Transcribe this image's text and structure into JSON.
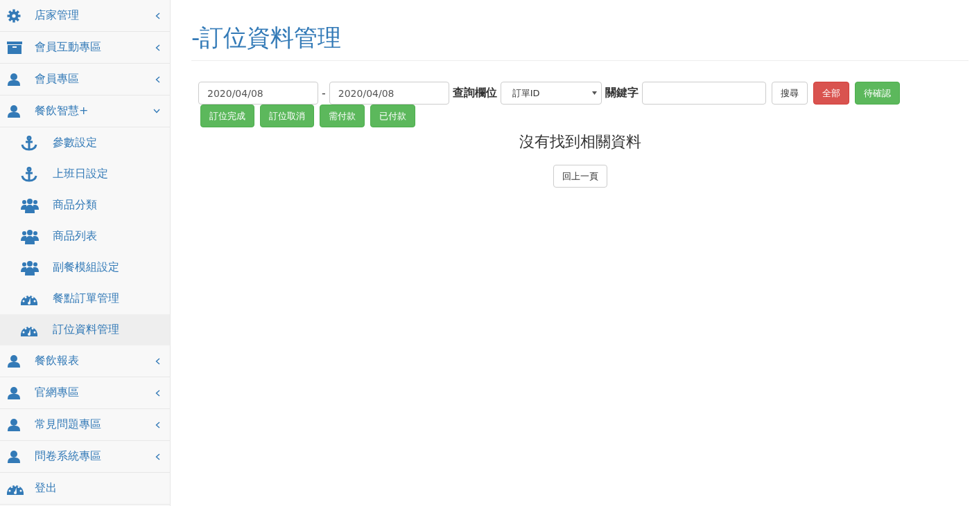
{
  "sidebar": {
    "items": [
      {
        "label": "店家管理",
        "kind": "menu",
        "expanded": false
      },
      {
        "label": "會員互動專區",
        "kind": "menu",
        "expanded": false
      },
      {
        "label": "會員專區",
        "kind": "menu",
        "expanded": false
      },
      {
        "label": "餐飲智慧+",
        "kind": "menu",
        "expanded": true,
        "children": [
          {
            "label": "參數設定",
            "selected": false
          },
          {
            "label": "上班日設定",
            "selected": false
          },
          {
            "label": "商品分類",
            "selected": false
          },
          {
            "label": "商品列表",
            "selected": false
          },
          {
            "label": "副餐模組設定",
            "selected": false
          },
          {
            "label": "餐點訂單管理",
            "selected": false
          },
          {
            "label": "訂位資料管理",
            "selected": true
          }
        ]
      },
      {
        "label": "餐飲報表",
        "kind": "menu",
        "expanded": false
      },
      {
        "label": "官網專區",
        "kind": "menu",
        "expanded": false
      },
      {
        "label": "常見問題專區",
        "kind": "menu",
        "expanded": false
      },
      {
        "label": "問卷系統專區",
        "kind": "menu",
        "expanded": false
      },
      {
        "label": "登出",
        "kind": "link"
      }
    ]
  },
  "page": {
    "title": "-訂位資料管理"
  },
  "filter": {
    "date_from": "2020/04/08",
    "separator": "-",
    "date_to": "2020/04/08",
    "field_label": "查詢欄位",
    "field_value": "訂單ID",
    "keyword_label": "關鍵字",
    "buttons": [
      {
        "label": "搜尋",
        "kind": "default"
      },
      {
        "label": "全部",
        "kind": "danger"
      },
      {
        "label": "待確認",
        "kind": "success"
      },
      {
        "label": "訂位完成",
        "kind": "success"
      },
      {
        "label": "訂位取消",
        "kind": "success"
      },
      {
        "label": "需付款",
        "kind": "success"
      },
      {
        "label": "已付款",
        "kind": "success"
      }
    ]
  },
  "result": {
    "message": "沒有找到相關資料",
    "back_button": "回上一頁"
  }
}
